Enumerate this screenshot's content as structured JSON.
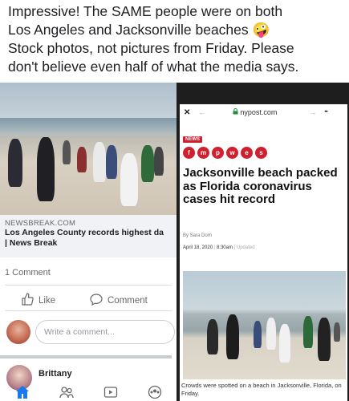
{
  "caption": {
    "line1": "Impressive! The SAME people were on both",
    "line2": "Los Angeles and Jacksonville beaches 🤪",
    "line3": "Stock photos, not pictures from Friday. Please",
    "line4": "don't believe even half of what the media says."
  },
  "fb_post": {
    "link_source": "NEWSBREAK.COM",
    "link_title_line1": "Los Angeles County records highest da",
    "link_title_line2": "| News Break",
    "comment_count": "1 Comment",
    "like_label": "Like",
    "comment_label": "Comment",
    "comment_placeholder": "Write a comment...",
    "commenter_name": "Brittany"
  },
  "phone": {
    "close": "✕",
    "back_arrow": "←",
    "url": "nypost.com",
    "forward_arrow": "→",
    "more": "•••",
    "news_tag": "NEWS",
    "share_icons": [
      "f",
      "m",
      "p",
      "w",
      "e",
      "s"
    ],
    "headline": "Jacksonville beach packed as Florida coronavirus cases hit record",
    "author": "By Sara Dorn",
    "date": "April 18, 2020",
    "time": "8:30am",
    "updated": "Updated",
    "photo_caption": "Crowds were spotted on a beach in Jacksonville, Florida, on Friday."
  },
  "colors": {
    "fb_blue": "#1877f2",
    "post_red": "#d0202f",
    "secure_green": "#1a8c3c"
  }
}
